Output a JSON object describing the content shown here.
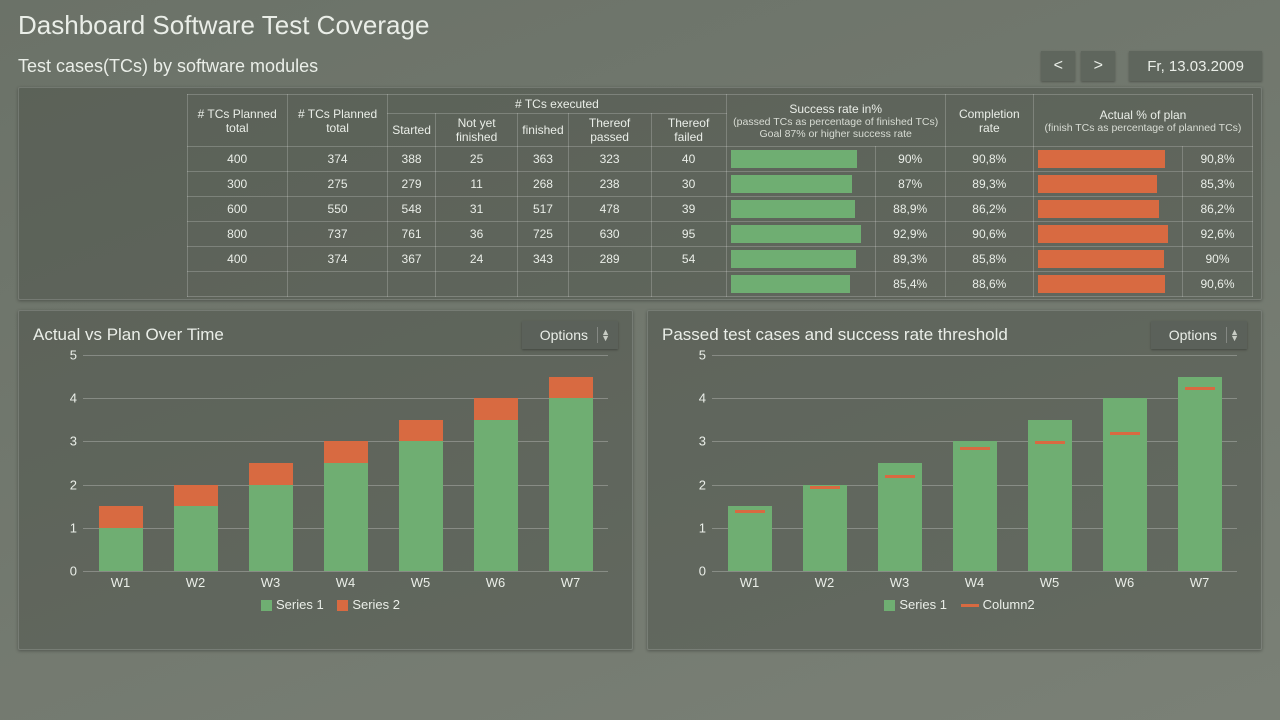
{
  "title": "Dashboard Software Test Coverage",
  "subtitle": "Test cases(TCs) by software modules",
  "nav": {
    "prev": "<",
    "next": ">"
  },
  "date": "Fr, 13.03.2009",
  "table": {
    "headers": {
      "planned1": "# TCs Planned total",
      "planned2": "# TCs Planned total",
      "exec_group": "# TCs executed",
      "started": "Started",
      "not_finished": "Not yet finished",
      "finished": "finished",
      "passed": "Thereof passed",
      "failed": "Thereof failed",
      "success_group": "Success rate in%",
      "success_sub1": "(passed TCs as percentage of finished TCs)",
      "success_sub2": "Goal 87% or higher success rate",
      "completion": "Completion rate",
      "actual_group": "Actual % of plan",
      "actual_sub": "(finish TCs as percentage of planned TCs)"
    },
    "rows": [
      {
        "p1": "400",
        "p2": "374",
        "started": "388",
        "nf": "25",
        "fin": "363",
        "pass": "323",
        "fail": "40",
        "succ_pct": 90,
        "succ_txt": "90%",
        "comp": "90,8%",
        "plan_pct": 90.8,
        "plan_txt": "90,8%"
      },
      {
        "p1": "300",
        "p2": "275",
        "started": "279",
        "nf": "11",
        "fin": "268",
        "pass": "238",
        "fail": "30",
        "succ_pct": 87,
        "succ_txt": "87%",
        "comp": "89,3%",
        "plan_pct": 85.3,
        "plan_txt": "85,3%"
      },
      {
        "p1": "600",
        "p2": "550",
        "started": "548",
        "nf": "31",
        "fin": "517",
        "pass": "478",
        "fail": "39",
        "succ_pct": 88.9,
        "succ_txt": "88,9%",
        "comp": "86,2%",
        "plan_pct": 86.2,
        "plan_txt": "86,2%"
      },
      {
        "p1": "800",
        "p2": "737",
        "started": "761",
        "nf": "36",
        "fin": "725",
        "pass": "630",
        "fail": "95",
        "succ_pct": 92.9,
        "succ_txt": "92,9%",
        "comp": "90,6%",
        "plan_pct": 92.6,
        "plan_txt": "92,6%"
      },
      {
        "p1": "400",
        "p2": "374",
        "started": "367",
        "nf": "24",
        "fin": "343",
        "pass": "289",
        "fail": "54",
        "succ_pct": 89.3,
        "succ_txt": "89,3%",
        "comp": "85,8%",
        "plan_pct": 90,
        "plan_txt": "90%"
      },
      {
        "p1": "",
        "p2": "",
        "started": "",
        "nf": "",
        "fin": "",
        "pass": "",
        "fail": "",
        "succ_pct": 85.4,
        "succ_txt": "85,4%",
        "comp": "88,6%",
        "plan_pct": 90.6,
        "plan_txt": "90,6%"
      }
    ]
  },
  "chart_left": {
    "title": "Actual vs Plan Over Time",
    "options": "Options",
    "legend": {
      "s1": "Series 1",
      "s2": "Series 2"
    }
  },
  "chart_right": {
    "title": "Passed test cases and success rate threshold",
    "options": "Options",
    "legend": {
      "s1": "Series 1",
      "s2": "Column2"
    }
  },
  "chart_data": [
    {
      "id": "actual_vs_plan",
      "type": "bar",
      "stacked": true,
      "categories": [
        "W1",
        "W2",
        "W3",
        "W4",
        "W5",
        "W6",
        "W7"
      ],
      "series": [
        {
          "name": "Series 1",
          "color": "#6fae72",
          "values": [
            1.0,
            1.5,
            2.0,
            2.5,
            3.0,
            3.5,
            4.0
          ]
        },
        {
          "name": "Series 2",
          "color": "#d86a41",
          "values": [
            0.5,
            0.5,
            0.5,
            0.5,
            0.5,
            0.5,
            0.5
          ]
        }
      ],
      "ylim": [
        0,
        5
      ],
      "yticks": [
        0,
        1,
        2,
        3,
        4,
        5
      ]
    },
    {
      "id": "passed_threshold",
      "type": "bar",
      "categories": [
        "W1",
        "W2",
        "W3",
        "W4",
        "W5",
        "W6",
        "W7"
      ],
      "series": [
        {
          "name": "Series 1",
          "color": "#6fae72",
          "values": [
            1.5,
            2.0,
            2.5,
            3.0,
            3.5,
            4.0,
            4.5
          ]
        },
        {
          "name": "Column2",
          "color": "#d86a41",
          "type": "marker",
          "values": [
            1.35,
            1.9,
            2.15,
            2.8,
            2.95,
            3.15,
            4.2
          ]
        }
      ],
      "ylim": [
        0,
        5
      ],
      "yticks": [
        0,
        1,
        2,
        3,
        4,
        5
      ]
    }
  ]
}
